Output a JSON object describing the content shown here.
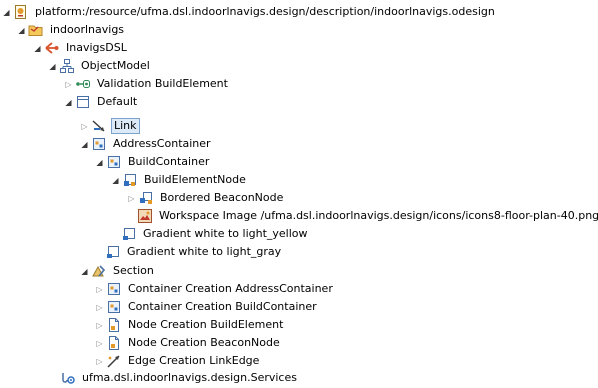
{
  "tree": {
    "root": "platform:/resource/ufma.dsl.indoorlnavigs.design/description/indoorlnavigs.odesign",
    "group": "indoorlnavigs",
    "viewpoint": "InavigsDSL",
    "representation": "ObjectModel",
    "validation": "Validation BuildElement",
    "layer": "Default",
    "link": "Link",
    "address_container": "AddressContainer",
    "build_container": "BuildContainer",
    "build_element_node": "BuildElementNode",
    "bordered_node": "Bordered BeaconNode",
    "workspace_image": "Workspace Image /ufma.dsl.indoorlnavigs.design/icons/icons8-floor-plan-40.png",
    "gradient_yellow": "Gradient white to light_yellow",
    "gradient_gray": "Gradient white to light_gray",
    "section": "Section",
    "tool_address": "Container Creation AddressContainer",
    "tool_build": "Container Creation BuildContainer",
    "tool_node_build": "Node Creation BuildElement",
    "tool_node_beacon": "Node Creation BeaconNode",
    "tool_edge": "Edge Creation LinkEdge",
    "services": "ufma.dsl.indoorlnavigs.design.Services"
  },
  "colors": {
    "selection_bg": "#dce9f7",
    "selection_border": "#7da2ce"
  }
}
